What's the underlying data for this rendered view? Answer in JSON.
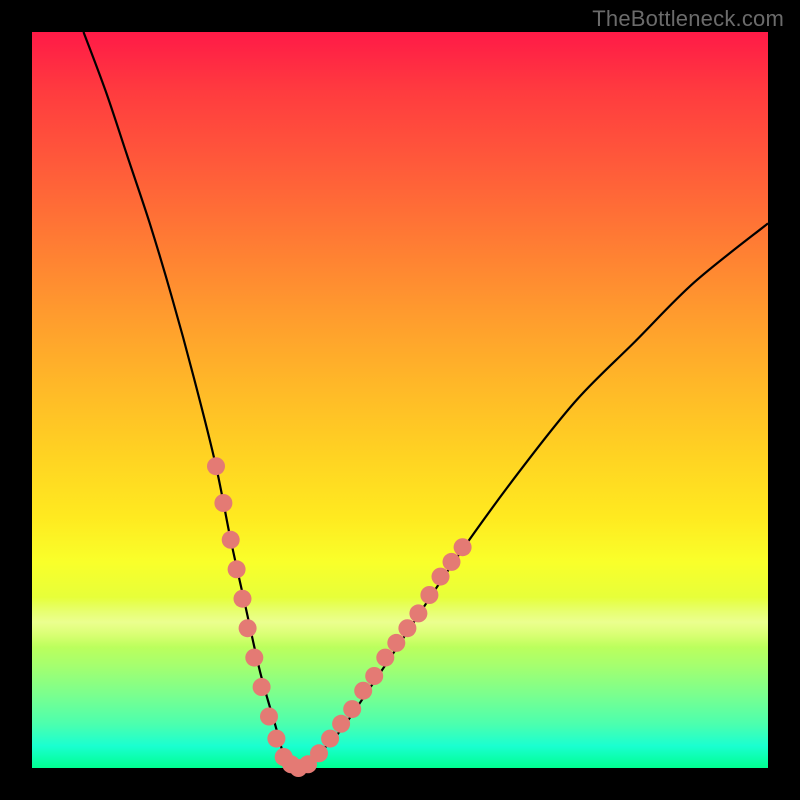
{
  "watermark": "TheBottleneck.com",
  "chart_data": {
    "type": "line",
    "title": "",
    "xlabel": "",
    "ylabel": "",
    "xlim": [
      0,
      100
    ],
    "ylim": [
      0,
      100
    ],
    "series": [
      {
        "name": "bottleneck-curve",
        "x": [
          7,
          10,
          13,
          16,
          19,
          22,
          25,
          27,
          29,
          31,
          33,
          34.5,
          36,
          41,
          46,
          52,
          58,
          66,
          74,
          82,
          90,
          100
        ],
        "values": [
          100,
          92,
          83,
          74,
          64,
          53,
          41,
          31,
          22,
          13,
          6,
          1,
          0,
          4,
          11,
          20,
          29,
          40,
          50,
          58,
          66,
          74
        ]
      }
    ],
    "markers": {
      "name": "highlight-dots",
      "color": "#e47a74",
      "points": [
        {
          "x": 25.0,
          "y": 41
        },
        {
          "x": 26.0,
          "y": 36
        },
        {
          "x": 27.0,
          "y": 31
        },
        {
          "x": 27.8,
          "y": 27
        },
        {
          "x": 28.6,
          "y": 23
        },
        {
          "x": 29.3,
          "y": 19
        },
        {
          "x": 30.2,
          "y": 15
        },
        {
          "x": 31.2,
          "y": 11
        },
        {
          "x": 32.2,
          "y": 7
        },
        {
          "x": 33.2,
          "y": 4
        },
        {
          "x": 34.2,
          "y": 1.5
        },
        {
          "x": 35.2,
          "y": 0.5
        },
        {
          "x": 36.2,
          "y": 0
        },
        {
          "x": 37.5,
          "y": 0.5
        },
        {
          "x": 39.0,
          "y": 2
        },
        {
          "x": 40.5,
          "y": 4
        },
        {
          "x": 42.0,
          "y": 6
        },
        {
          "x": 43.5,
          "y": 8
        },
        {
          "x": 45.0,
          "y": 10.5
        },
        {
          "x": 46.5,
          "y": 12.5
        },
        {
          "x": 48.0,
          "y": 15
        },
        {
          "x": 49.5,
          "y": 17
        },
        {
          "x": 51.0,
          "y": 19
        },
        {
          "x": 52.5,
          "y": 21
        },
        {
          "x": 54.0,
          "y": 23.5
        },
        {
          "x": 55.5,
          "y": 26
        },
        {
          "x": 57.0,
          "y": 28
        },
        {
          "x": 58.5,
          "y": 30
        }
      ]
    }
  }
}
